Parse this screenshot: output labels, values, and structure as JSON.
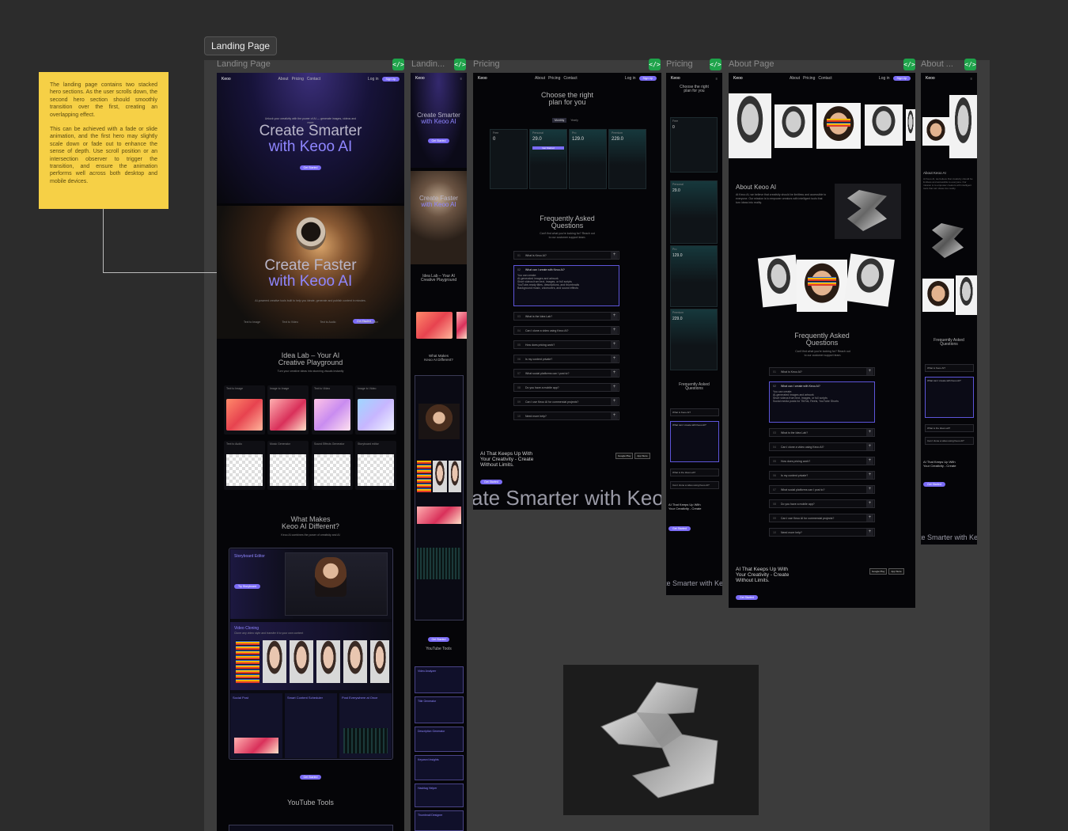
{
  "section": {
    "title": "Landing Page"
  },
  "sticky_note": {
    "p1": "The landing page contains two stacked hero sections. As the user scrolls down, the second hero section should smoothly transition over the first, creating an overlapping effect.",
    "p2": "This can be achieved with a fade or slide animation, and the first hero may slightly scale down or fade out to enhance the sense of depth. Use scroll position or an intersection observer to trigger the transition, and ensure the animation performs well across both desktop and mobile devices."
  },
  "frames": {
    "landing_desktop": "Landing Page",
    "landing_mobile": "Landin...",
    "pricing_desktop": "Pricing",
    "pricing_mobile": "Pricing",
    "about_desktop": "About Page",
    "about_mobile": "About ..."
  },
  "code_icon": "</>",
  "nav": {
    "logo": "Keoo",
    "links": [
      "About",
      "Pricing",
      "Contact"
    ],
    "login": "Log in",
    "cta": "Sign Up"
  },
  "hero1": {
    "line1": "Create Smarter",
    "line2": "with Keoo AI",
    "cta": "Get Started",
    "tagline": "Unlock your creativity with the power of AI — generate images, videos and more"
  },
  "hero2": {
    "line1": "Create Faster",
    "line2": "with Keoo AI",
    "cta": "Get Started",
    "desc": "AI-powered creative tools built to help you ideate, generate and publish content in minutes."
  },
  "hero_mobile": {
    "line1": "Create Smarter",
    "line2": "with Keoo AI",
    "line3": "Create Faster",
    "line4": "with Keoo AI"
  },
  "idea_lab": {
    "title1": "Idea Lab – Your AI",
    "title2": "Creative Playground",
    "sub": "Turn your creative ideas into stunning visuals instantly",
    "cards": [
      "Text to Image",
      "Image to Image",
      "Text to Video",
      "Image to Video",
      "Text to Audio",
      "Music Generator",
      "Sound Effects Generator",
      "Storyboard editor"
    ]
  },
  "different": {
    "title1": "What Makes",
    "title2": "Keoo AI Different?",
    "sub": "Keoo AI combines the power of creativity and AI",
    "f1": "Storyboard Editor",
    "f1_cta": "Try Storyboard",
    "f2": "Video Cloning",
    "f2_desc": "Clone any video style and transfer it to your own content",
    "f3": "Social Post",
    "f4": "Smart Content Scheduler",
    "f5": "Post Everywhere at Once",
    "cta": "Get Started"
  },
  "youtube": {
    "title": "YouTube Tools",
    "items": [
      "Video Analyzer",
      "Title Generator",
      "Description Generator",
      "Keyword Insights",
      "Hashtag Helper",
      "Thumbnail Designer"
    ]
  },
  "pricing": {
    "title1": "Choose the right",
    "title2": "plan for you",
    "toggle": [
      "Monthly",
      "Yearly"
    ],
    "plans": [
      {
        "name": "Free",
        "price": "0"
      },
      {
        "name": "Personal",
        "price": "29.0"
      },
      {
        "name": "Pro",
        "price": "129.0"
      },
      {
        "name": "Premium",
        "price": "229.0"
      }
    ],
    "plan_cta": "Get Started"
  },
  "faq": {
    "title1": "Frequently Asked",
    "title2": "Questions",
    "sub": "Can't find what you're looking for? Reach out to our customer support team.",
    "items": [
      {
        "n": "01",
        "q": "What is Keoo AI?"
      },
      {
        "n": "02",
        "q": "What can I create with Keoo AI?"
      },
      {
        "n": "03",
        "q": "What is the Idea Lab?"
      },
      {
        "n": "04",
        "q": "Can I clone a video using Keoo AI?"
      },
      {
        "n": "05",
        "q": "How does pricing work?"
      },
      {
        "n": "06",
        "q": "Is my content private?"
      },
      {
        "n": "07",
        "q": "What social platforms can I post to?"
      },
      {
        "n": "08",
        "q": "Do you have a mobile app?"
      },
      {
        "n": "09",
        "q": "Can I use Keoo AI for commercial projects?"
      },
      {
        "n": "10",
        "q": "Need more help?"
      }
    ],
    "answer_intro": "You can create:",
    "answer_lines": [
      "AI-generated images and artwork",
      "Short videos from text, images, or full scripts",
      "YouTube-ready titles, descriptions, and thumbnails",
      "Background music, voiceovers, and sound effects",
      "Social media posts for TikTok, Reels, YouTube Shorts"
    ]
  },
  "footer": {
    "line1": "AI That Keeps Up With",
    "line2": "Your Creativity - Create",
    "line3": "Without Limits.",
    "cta": "Get Started",
    "marquee": "ate Smarter with Keo",
    "marquee_mobile": "te Smarter with Ke",
    "store1": "Google Play",
    "store2": "App Store"
  },
  "about": {
    "title": "About Keoo AI",
    "text": "At Keoo AI, we believe that creativity should be limitless and accessible to everyone. Our mission is to empower creators with intelligent tools that turn ideas into reality.",
    "faq_title1": "Frequently Asked",
    "faq_title2": "Questions"
  }
}
